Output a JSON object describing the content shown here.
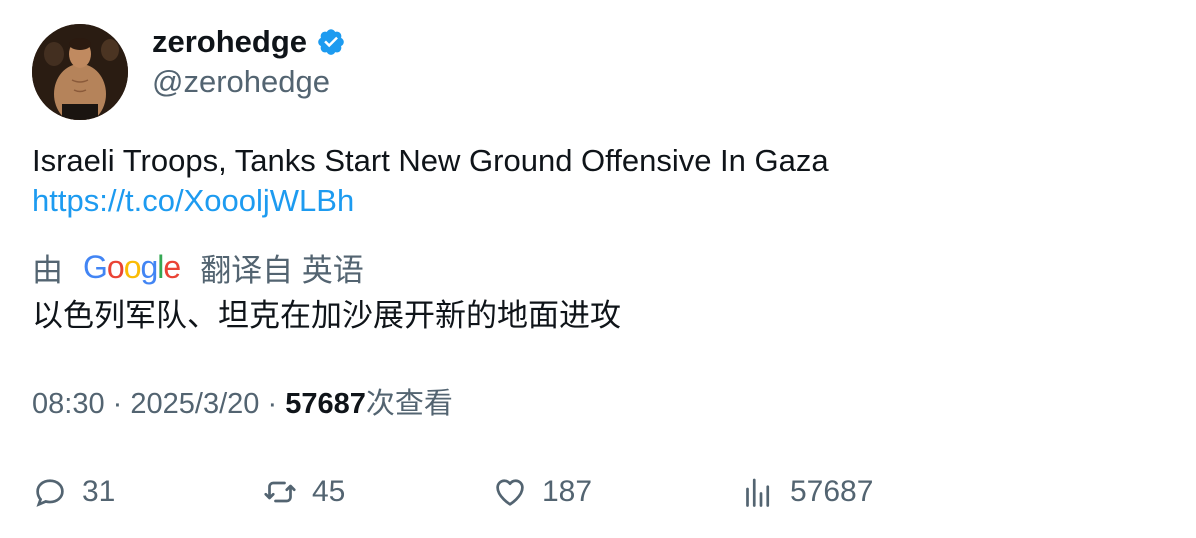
{
  "author": {
    "display_name": "zerohedge",
    "handle": "@zerohedge",
    "verified_icon": "verified-badge-icon",
    "avatar": "avatar-photo"
  },
  "tweet": {
    "text": "Israeli Troops, Tanks Start New Ground Offensive In Gaza",
    "link": "https://t.co/XooolјWLBh"
  },
  "translation": {
    "by_label": "由",
    "provider_letters": [
      "G",
      "o",
      "o",
      "g",
      "l",
      "e"
    ],
    "translated_from_label": "翻译自 英语",
    "translated_text": "以色列军队、坦克在加沙展开新的地面进攻"
  },
  "meta": {
    "time": "08:30",
    "separator": "·",
    "date": "2025/3/20",
    "views_count": "57687",
    "views_label": "次查看"
  },
  "actions": {
    "replies": "31",
    "retweets": "45",
    "likes": "187",
    "views": "57687"
  },
  "colors": {
    "link": "#1d9bf0",
    "secondary_text": "#536471",
    "primary_text": "#0f1419",
    "verified": "#1d9bf0"
  }
}
